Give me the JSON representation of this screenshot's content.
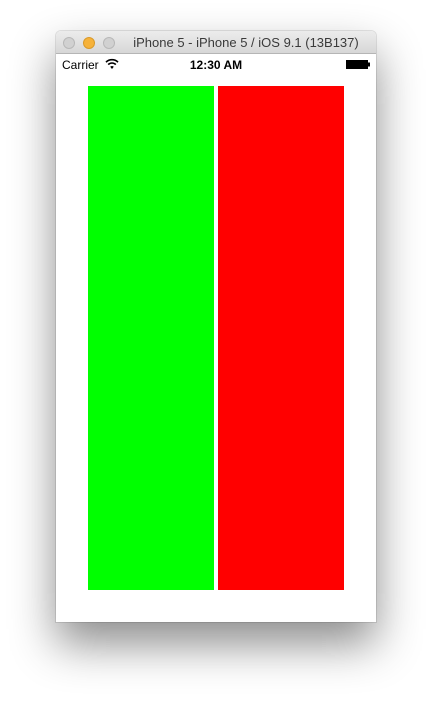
{
  "window": {
    "title": "iPhone 5 - iPhone 5 / iOS 9.1 (13B137)"
  },
  "statusbar": {
    "carrier": "Carrier",
    "time": "12:30 AM",
    "wifi_icon": "wifi-icon",
    "battery_icon": "battery-icon"
  },
  "content": {
    "left_panel_color": "#00ff00",
    "right_panel_color": "#ff0000"
  }
}
